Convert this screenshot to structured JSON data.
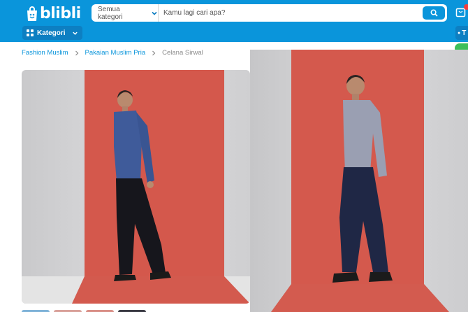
{
  "header": {
    "logo_text": "blibli",
    "brand_color": "#0a95db",
    "search": {
      "category_label": "Semua kategori",
      "placeholder": "Kamu lagi cari apa?",
      "button_icon": "search-icon"
    },
    "kategori_label": "Kategori",
    "right_partial_label": "T"
  },
  "breadcrumb": {
    "items": [
      "Fashion Muslim",
      "Pakaian Muslim Pria"
    ],
    "current": "Celana Sirwal"
  },
  "product_images": {
    "main": "model in blue shirt and black sirwal pants on red backdrop",
    "zoom": "model in grey shirt and navy sirwal pants on red backdrop"
  }
}
